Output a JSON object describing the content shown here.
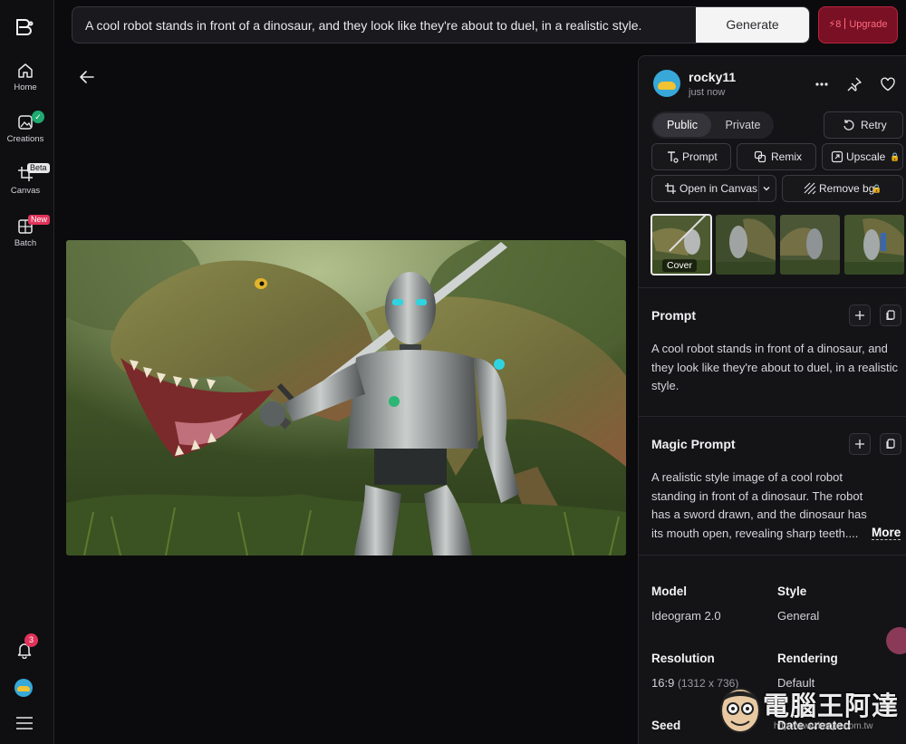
{
  "sidebar": {
    "items": [
      {
        "label": "Home",
        "icon": "home-icon"
      },
      {
        "label": "Creations",
        "icon": "image-gallery-icon"
      },
      {
        "label": "Canvas",
        "icon": "crop-canvas-icon",
        "tag": "Beta"
      },
      {
        "label": "Batch",
        "icon": "batch-grid-icon",
        "tag": "New"
      }
    ],
    "notifications_count": "3"
  },
  "topbar": {
    "prompt_text": "A cool robot stands in front of a dinosaur, and they look like they're about to duel, in a realistic style.",
    "generate_label": "Generate",
    "credits": "8",
    "upgrade_label": "Upgrade"
  },
  "panel": {
    "username": "rocky11",
    "time": "just now",
    "visibility": {
      "public": "Public",
      "private": "Private"
    },
    "retry_label": "Retry",
    "prompt_btn": "Prompt",
    "remix_btn": "Remix",
    "upscale_btn": "Upscale",
    "open_canvas_btn": "Open in Canvas",
    "remove_bg_btn": "Remove bg",
    "cover_label": "Cover",
    "prompt_title": "Prompt",
    "prompt_body": "A cool robot stands in front of a dinosaur, and they look like they're about to duel, in a realistic style.",
    "magic_title": "Magic Prompt",
    "magic_body": "A realistic style image of a cool robot standing in front of a dinosaur. The robot has a sword drawn, and the dinosaur has its mouth open, revealing sharp teeth....",
    "more_label": "More",
    "meta": {
      "model_k": "Model",
      "model_v": "Ideogram 2.0",
      "style_k": "Style",
      "style_v": "General",
      "resolution_k": "Resolution",
      "resolution_v": "16:9",
      "resolution_px": "(1312 x 736)",
      "rendering_k": "Rendering",
      "rendering_v": "Default",
      "seed_k": "Seed",
      "date_k": "Date created"
    }
  },
  "watermark": {
    "text": "電腦王阿達",
    "url": "http://www.kocpc.com.tw"
  },
  "colors": {
    "accent_red": "#e0335a",
    "upgrade_bg": "#7a1024",
    "check_green": "#1fa971"
  }
}
